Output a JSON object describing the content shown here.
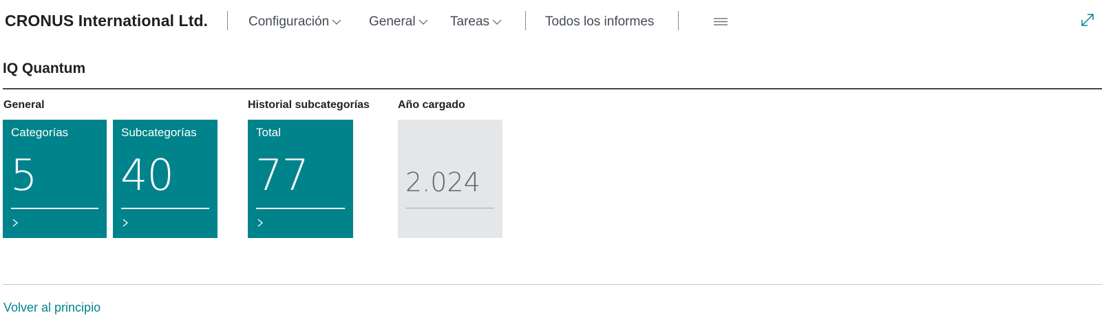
{
  "header": {
    "company": "CRONUS International Ltd.",
    "nav": [
      {
        "label": "Configuración",
        "icon": "chevron-down-icon"
      },
      {
        "label": "General",
        "icon": "chevron-down-icon"
      },
      {
        "label": "Tareas",
        "icon": "chevron-down-icon"
      },
      {
        "label": "Todos los informes"
      }
    ],
    "menu_icon": "hamburger-menu-icon",
    "expand_icon": "expand-diagonal-icon"
  },
  "page": {
    "title": "IQ Quantum"
  },
  "groups": [
    {
      "label": "General",
      "tiles": [
        {
          "label": "Categorías",
          "value": "5"
        },
        {
          "label": "Subcategorías",
          "value": "40"
        }
      ]
    },
    {
      "label": "Historial subcategorías",
      "tiles": [
        {
          "label": "Total",
          "value": "77"
        }
      ]
    },
    {
      "label": "Año cargado",
      "tiles": [
        {
          "label": "",
          "value": "2.024"
        }
      ]
    }
  ],
  "footer": {
    "back_to_top": "Volver al principio"
  },
  "colors": {
    "accent": "#00838b",
    "tile_gray": "#e5e6e8",
    "text": "#212121",
    "nav_text": "#444b55"
  }
}
